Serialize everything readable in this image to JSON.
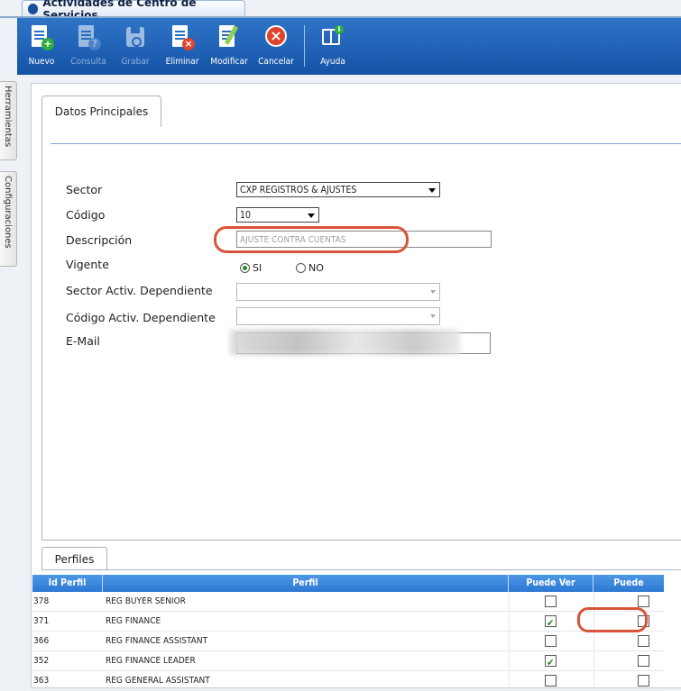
{
  "window": {
    "title": "Actividades de Centro de Servicios"
  },
  "toolbar": {
    "buttons": [
      {
        "id": "nuevo",
        "label": "Nuevo",
        "icon": "document-add-icon",
        "enabled": true
      },
      {
        "id": "consulta",
        "label": "Consulta",
        "icon": "document-query-icon",
        "enabled": false
      },
      {
        "id": "grabar",
        "label": "Grabar",
        "icon": "save-icon",
        "enabled": false
      },
      {
        "id": "eliminar",
        "label": "Eliminar",
        "icon": "document-delete-icon",
        "enabled": true
      },
      {
        "id": "modificar",
        "label": "Modificar",
        "icon": "edit-icon",
        "enabled": true
      },
      {
        "id": "cancelar",
        "label": "Cancelar",
        "icon": "cancel-icon",
        "enabled": true
      },
      {
        "id": "ayuda",
        "label": "Ayuda",
        "icon": "help-book-icon",
        "enabled": true
      }
    ]
  },
  "side_tabs": [
    "Herramientas",
    "Configuraciones"
  ],
  "main_tab": "Datos Principales",
  "form": {
    "sector_label": "Sector",
    "sector_value": "CXP REGISTROS & AJUSTES",
    "codigo_label": "Código",
    "codigo_value": "10",
    "descripcion_label": "Descripción",
    "descripcion_value": "AJUSTE CONTRA CUENTAS",
    "vigente_label": "Vigente",
    "vigente_si": "SI",
    "vigente_no": "NO",
    "vigente_selected": "SI",
    "sector_dep_label": "Sector Activ. Dependiente",
    "codigo_dep_label": "Código Activ. Dependiente",
    "email_label": "E-Mail"
  },
  "perfiles": {
    "tab": "Perfiles",
    "columns": [
      "Id Perfil",
      "Perfil",
      "Puede Ver",
      "Puede Ejecutar"
    ],
    "rows": [
      {
        "id": "378",
        "perfil": "REG BUYER SENIOR",
        "ver": false,
        "ejecutar": false
      },
      {
        "id": "371",
        "perfil": "REG FINANCE",
        "ver": true,
        "ejecutar": false
      },
      {
        "id": "366",
        "perfil": "REG FINANCE ASSISTANT",
        "ver": false,
        "ejecutar": false
      },
      {
        "id": "352",
        "perfil": "REG FINANCE LEADER",
        "ver": true,
        "ejecutar": false
      },
      {
        "id": "363",
        "perfil": "REG GENERAL ASSISTANT",
        "ver": false,
        "ejecutar": false
      }
    ]
  },
  "colors": {
    "toolbar": "#1e62b8",
    "grid_header": "#3a86dc",
    "highlight": "#d9533a",
    "check": "#1e8a1e"
  }
}
